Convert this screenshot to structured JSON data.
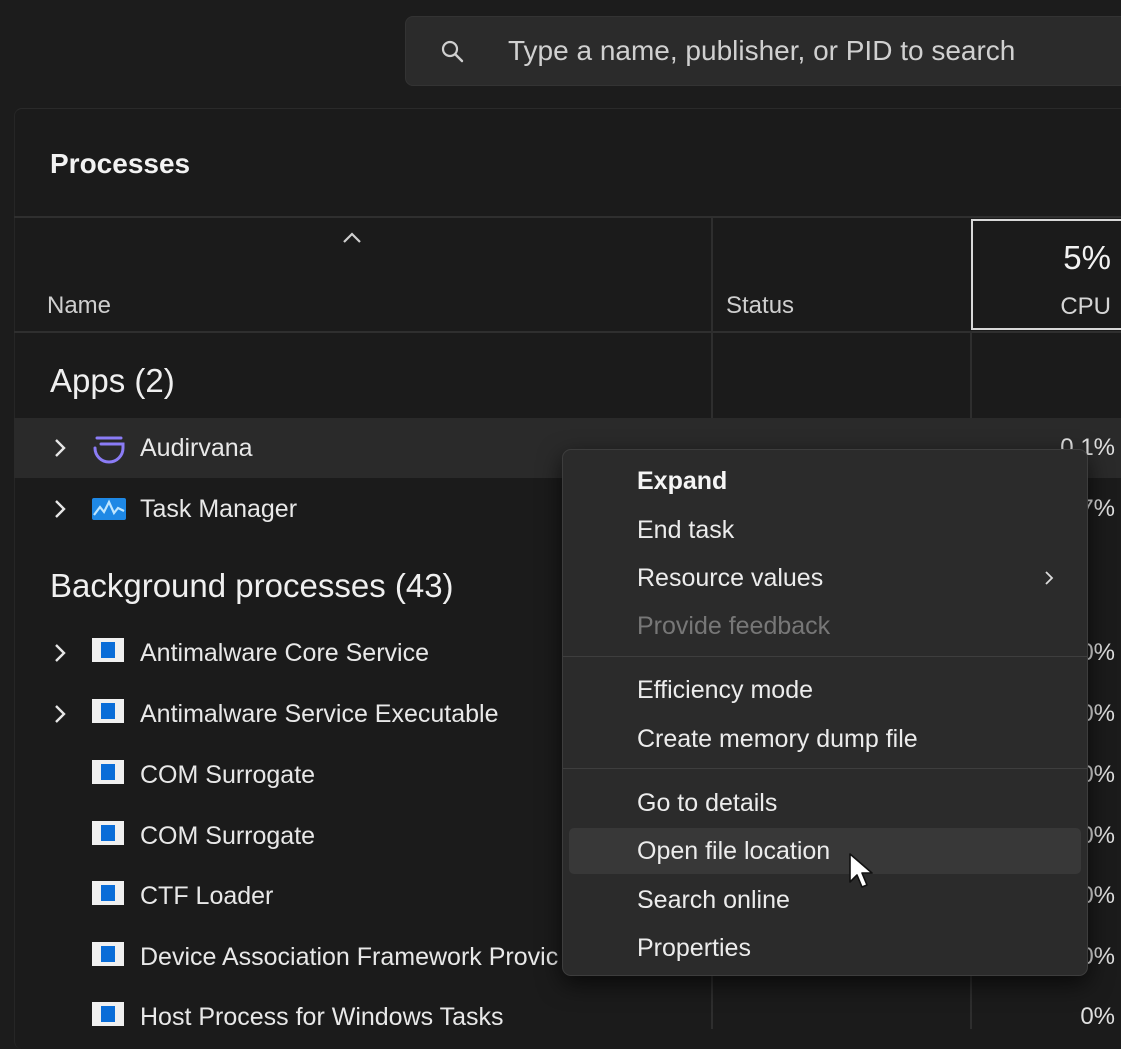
{
  "search": {
    "placeholder": "Type a name, publisher, or PID to search",
    "icon": "search-icon"
  },
  "panel": {
    "title": "Processes"
  },
  "columns": {
    "name": "Name",
    "status": "Status",
    "cpu_total": "5%",
    "cpu_label": "CPU"
  },
  "groups": {
    "apps": "Apps (2)",
    "background": "Background processes (43)"
  },
  "apps": [
    {
      "name": "Audirvana",
      "cpu": "0.1%",
      "expandable": true,
      "icon": "audirvana-icon"
    },
    {
      "name": "Task Manager",
      "cpu": "7%",
      "expandable": true,
      "icon": "task-manager-icon"
    }
  ],
  "background": [
    {
      "name": "Antimalware Core Service",
      "cpu": "0%",
      "expandable": true
    },
    {
      "name": "Antimalware Service Executable",
      "cpu": "0%",
      "expandable": true
    },
    {
      "name": "COM Surrogate",
      "cpu": "0%",
      "expandable": false
    },
    {
      "name": "COM Surrogate",
      "cpu": "0%",
      "expandable": false
    },
    {
      "name": "CTF Loader",
      "cpu": "0%",
      "expandable": false
    },
    {
      "name": "Device Association Framework Provic",
      "cpu": "0%",
      "expandable": false
    },
    {
      "name": "Host Process for Windows Tasks",
      "cpu": "0%",
      "expandable": false
    }
  ],
  "context_menu": {
    "items": [
      {
        "label": "Expand",
        "bold": true
      },
      {
        "label": "End task"
      },
      {
        "label": "Resource values",
        "submenu": true
      },
      {
        "label": "Provide feedback",
        "disabled": true
      },
      {
        "label": "Efficiency mode"
      },
      {
        "label": "Create memory dump file"
      },
      {
        "label": "Go to details"
      },
      {
        "label": "Open file location",
        "hovered": true
      },
      {
        "label": "Search online"
      },
      {
        "label": "Properties"
      }
    ]
  },
  "colors": {
    "accent": "#0a6dd8",
    "background": "#1c1c1c",
    "menu": "#2b2b2b"
  }
}
